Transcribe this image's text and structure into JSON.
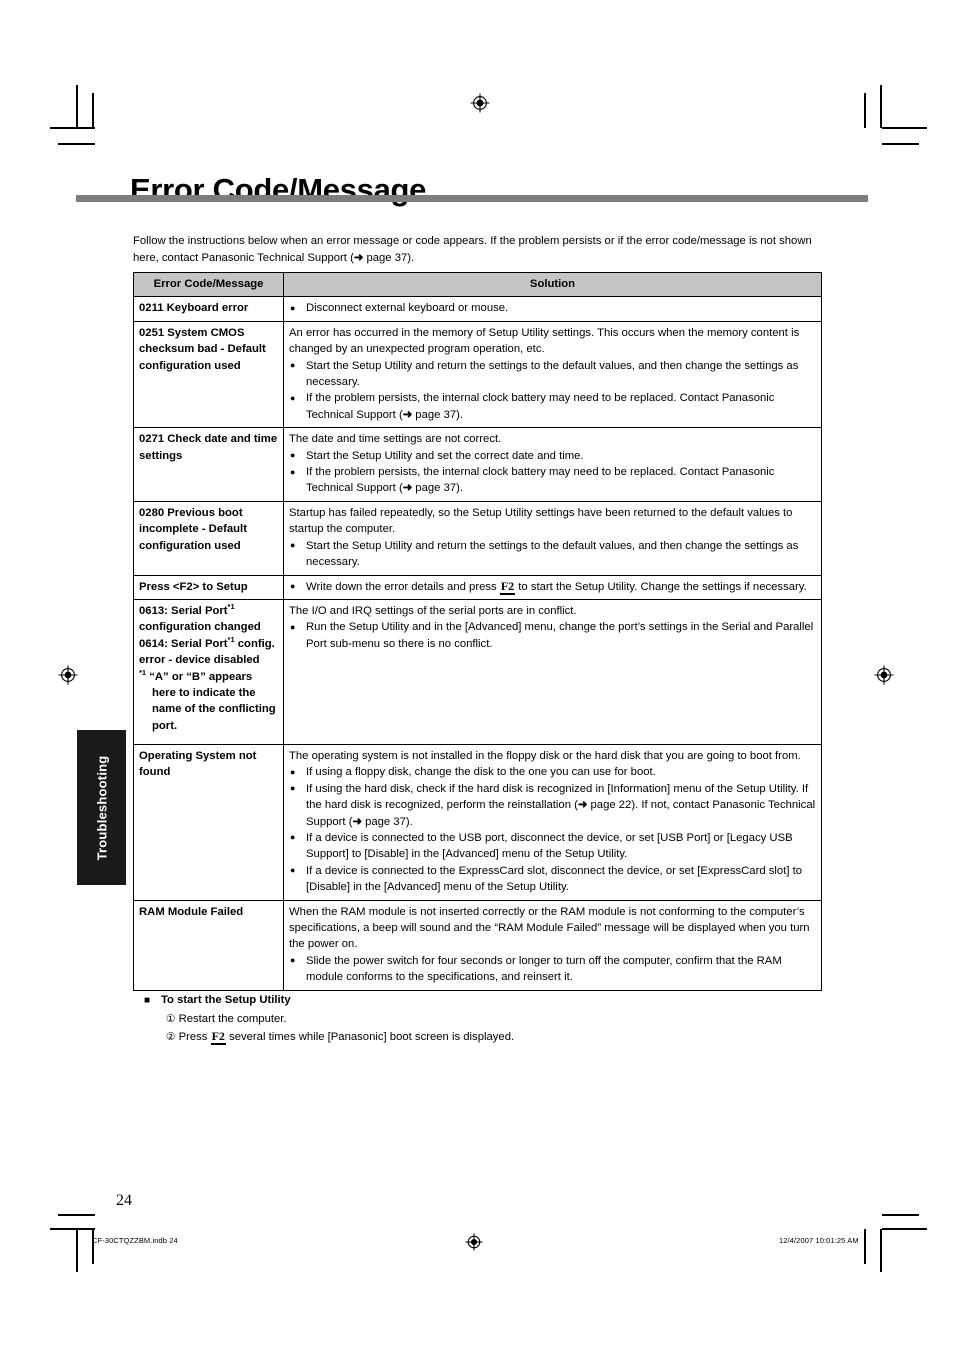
{
  "page": {
    "title": "Error Code/Message",
    "intro": "Follow the instructions below when an error message or code appears. If the problem persists or if the error code/message is not shown here, contact Panasonic Technical Support (➜ page 37).",
    "thumb_tab": "Troubleshooting",
    "page_number": "24"
  },
  "table": {
    "headers": {
      "code": "Error Code/Message",
      "solution": "Solution"
    },
    "rows": [
      {
        "code": "0211 Keyboard error",
        "lead": "",
        "bullets": [
          "Disconnect external keyboard or mouse."
        ]
      },
      {
        "code": "0251 System CMOS checksum bad - Default configuration used",
        "lead": "An error has occurred in the memory of Setup Utility settings. This occurs when the memory content is changed by an unexpected program operation, etc.",
        "bullets": [
          "Start the Setup Utility and return the settings to the default values, and then change the settings as necessary.",
          "If the problem persists, the internal clock battery may need to be replaced. Contact Panasonic Technical Support (➜ page 37)."
        ]
      },
      {
        "code": "0271 Check date and time settings",
        "lead": "The date and time settings are not correct.",
        "bullets": [
          "Start the Setup Utility and set the correct date and time.",
          "If the problem persists, the internal clock battery may need to be replaced. Contact Panasonic Technical Support (➜ page 37)."
        ]
      },
      {
        "code": "0280 Previous boot incomplete - Default configuration used",
        "lead": "Startup has failed repeatedly, so the Setup Utility settings have been returned to the default values to startup the computer.",
        "bullets": [
          "Start the Setup Utility and return the settings to the default values, and then change the settings as necessary."
        ]
      },
      {
        "code": "Press <F2> to Setup",
        "lead": "",
        "bullets": [
          "Write down the error details and press [F2] to start the Setup Utility. Change the settings if necessary."
        ]
      },
      {
        "code": "0613: Serial Port*1 configuration changed 0614: Serial Port*1 config. error - device disabled",
        "code_footnote": "*1 “A” or “B” appears here to indicate the name of the conflicting port.",
        "lead": "The I/O and IRQ settings of the serial ports are in conflict.",
        "bullets": [
          "Run the Setup Utility and in the [Advanced] menu, change the port’s settings in the Serial and Parallel Port sub-menu so there is no conflict."
        ]
      },
      {
        "code": "Operating System not found",
        "lead": "The operating system is not installed in the floppy disk or the hard disk that you are going to boot from.",
        "bullets": [
          "If using a floppy disk, change the disk to the one you can use for boot.",
          "If using the hard disk, check if the hard disk is recognized in [Information] menu of the Setup Utility. If the hard disk is recognized, perform the reinstallation (➜ page 22). If not, contact Panasonic Technical Support (➜ page 37).",
          "If a device is connected to the USB port, disconnect the device, or set [USB Port] or [Legacy USB Support] to [Disable] in the [Advanced] menu of the Setup Utility.",
          "If a device is connected to the ExpressCard slot, disconnect the device, or set [ExpressCard slot] to [Disable] in the [Advanced] menu of the Setup Utility."
        ]
      },
      {
        "code": "RAM Module Failed",
        "lead": "When the RAM module is not inserted correctly or the RAM module is not conforming to the computer’s specifications, a beep will sound and the “RAM Module Failed” message will be displayed when you turn the power on.",
        "bullets": [
          "Slide the power switch for four seconds or longer to turn off the computer, confirm that the RAM module conforms to the specifications, and reinsert it."
        ]
      }
    ]
  },
  "setup_section": {
    "heading": "To start the Setup Utility",
    "steps": [
      {
        "num": "①",
        "text": "Restart the computer."
      },
      {
        "num": "②",
        "text_before": "Press ",
        "key": "F2",
        "text_after": " several times while [Panasonic] boot screen is displayed."
      }
    ]
  },
  "footer": {
    "left": "CF-30CTQZZBM.indb   24",
    "right": "12/4/2007   10:01:25 AM"
  },
  "cells": {
    "r0_b0": "Disconnect external keyboard or mouse.",
    "r1_lead": "An error has occurred in the memory of Setup Utility settings. This occurs when the memory content is changed by an unexpected program operation, etc.",
    "r1_b0": "Start the Setup Utility and return the settings to the default values, and then change the settings as necessary.",
    "r1_b1_a": "If the problem persists, the internal clock battery may need to be replaced. Contact Panasonic Technical Support (",
    "r1_b1_b": " page 37).",
    "r2_lead": "The date and time settings are not correct.",
    "r2_b0": "Start the Setup Utility and set the correct date and time.",
    "r3_lead": "Startup has failed repeatedly, so the Setup Utility settings have been returned to the default values to startup the computer.",
    "r3_b0": "Start the Setup Utility and return the settings to the default values, and then change the settings as necessary.",
    "r4_b0_a": "Write down the error details and press ",
    "r4_b0_b": " to start the Setup Utility. Change the settings if necessary.",
    "r5_code_1": "0613: Serial Port",
    "r5_code_2": " configuration changed",
    "r5_code_3": "0614: Serial Port",
    "r5_code_4": " config. error - device disabled",
    "r5_fn_mark": "*1",
    "r5_fn_text": "“A” or “B” appears here to indicate the name of the conflicting port.",
    "r5_lead": "The I/O and IRQ settings of the serial ports are in conflict.",
    "r5_b0": "Run the Setup Utility and in the [Advanced] menu, change the port’s settings in the Serial and Parallel Port sub-menu so there is no conflict.",
    "r6_lead": "The operating system is not installed in the floppy disk or the hard disk that you are going to boot from.",
    "r6_b0": "If using a floppy disk, change the disk to the one you can use for boot.",
    "r6_b1_a": "If using the hard disk, check if the hard disk is recognized in [Information] menu of the Setup Utility. If the hard disk is recognized, perform the reinstallation (",
    "r6_b1_b": " page 22). If not, contact Panasonic Technical Support (",
    "r6_b1_c": " page 37).",
    "r6_b2": "If a device is connected to the USB port, disconnect the device, or set [USB Port] or [Legacy USB Support] to [Disable] in the [Advanced] menu of the Setup Utility.",
    "r6_b3": "If a device is connected to the ExpressCard slot, disconnect the device, or set [ExpressCard slot] to [Disable] in the [Advanced] menu of the Setup Utility.",
    "r7_lead": "When the RAM module is not inserted correctly or the RAM module is not conforming to the computer’s specifications, a beep will sound and the “RAM Module Failed” message will be displayed when you turn the power on.",
    "r7_b0": "Slide the power switch for four seconds or longer to turn off the computer, confirm that the RAM module conforms to the specifications, and reinsert it."
  },
  "intro_parts": {
    "a": "Follow the instructions below when an error message or code appears. If the problem persists or if the error code/message is not shown here, contact Panasonic Technical Support (",
    "b": " page 37)."
  },
  "glyphs": {
    "arrow": "➜",
    "key_f2": "F2"
  },
  "colors": {
    "rule": "#7d7d7d",
    "header_fill": "#c4c4c4",
    "tab_fill": "#1a1a1a",
    "text": "#000000"
  }
}
